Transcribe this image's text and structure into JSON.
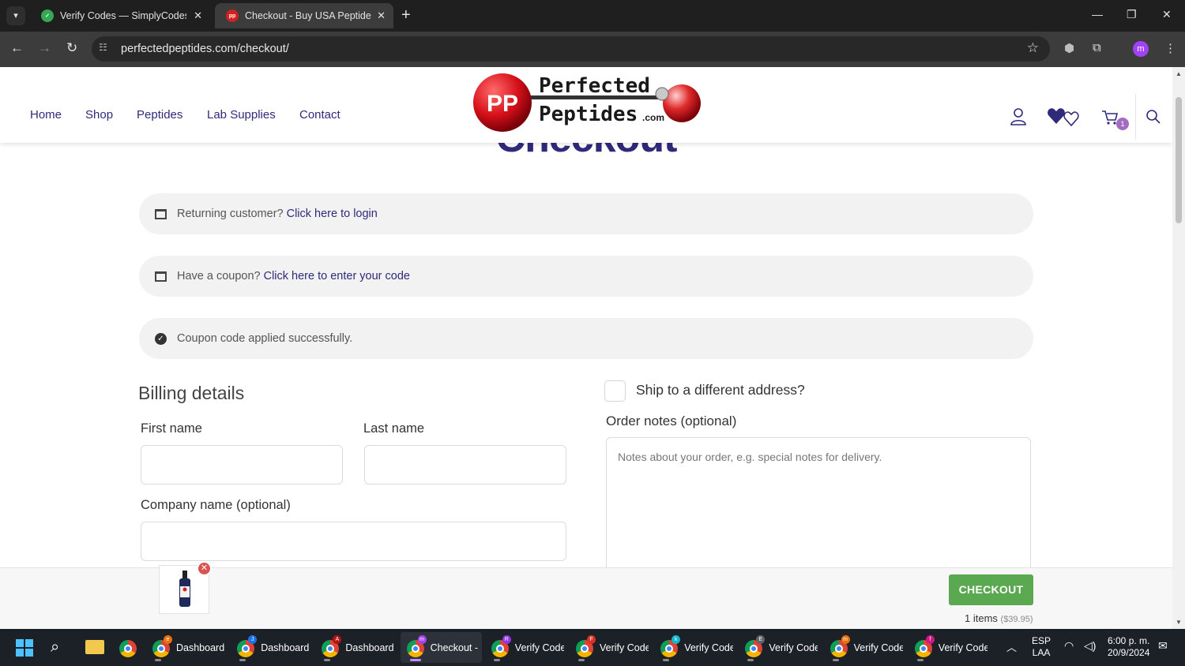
{
  "browser": {
    "tabs": [
      {
        "title": "Verify Codes — SimplyCodes",
        "active": false
      },
      {
        "title": "Checkout - Buy USA Peptides -",
        "active": true
      }
    ],
    "url": "perfectedpeptides.com/checkout/",
    "profile_initial": "m"
  },
  "site": {
    "nav": [
      "Home",
      "Shop",
      "Peptides",
      "Lab Supplies",
      "Contact"
    ],
    "logo": {
      "mark": "PP",
      "line1": "Perfected",
      "line2": "Peptides",
      "suffix": ".com"
    },
    "cart_count": "1"
  },
  "page": {
    "heading": "Checkout",
    "notices": [
      {
        "text": "Returning customer?",
        "link": "Click here to login"
      },
      {
        "text": "Have a coupon?",
        "link": "Click here to enter your code"
      },
      {
        "text": "Coupon code applied successfully.",
        "link": ""
      }
    ],
    "billing": {
      "title": "Billing details",
      "first_name_label": "First name",
      "last_name_label": "Last name",
      "company_label": "Company name (optional)"
    },
    "shipping": {
      "ship_different_label": "Ship to a different address?",
      "order_notes_label": "Order notes (optional)",
      "order_notes_placeholder": "Notes about your order, e.g. special notes for delivery."
    }
  },
  "cart_bar": {
    "checkout_label": "CHECKOUT",
    "items_text": "1 items",
    "total": "($39.95)"
  },
  "taskbar": {
    "apps": [
      {
        "label": "Dashboard",
        "badge": "e",
        "badge_color": "#e8710a"
      },
      {
        "label": "Dashboard",
        "badge": "J",
        "badge_color": "#1a73e8"
      },
      {
        "label": "Dashboard",
        "badge": "A",
        "badge_color": "#b31412"
      },
      {
        "label": "Checkout -",
        "badge": "m",
        "badge_color": "#a142f4",
        "active": true
      },
      {
        "label": "Verify Code",
        "badge": "R",
        "badge_color": "#9334e6"
      },
      {
        "label": "Verify Code",
        "badge": "F",
        "badge_color": "#d93025"
      },
      {
        "label": "Verify Code",
        "badge": "k",
        "badge_color": "#12b5cb"
      },
      {
        "label": "Verify Code",
        "badge": "E",
        "badge_color": "#5f6368"
      },
      {
        "label": "Verify Code",
        "badge": "m",
        "badge_color": "#e8710a"
      },
      {
        "label": "Verify Code",
        "badge": "f",
        "badge_color": "#d01884"
      }
    ],
    "language": "ESP",
    "layout": "LAA",
    "time": "6:00 p. m.",
    "date": "20/9/2024"
  }
}
